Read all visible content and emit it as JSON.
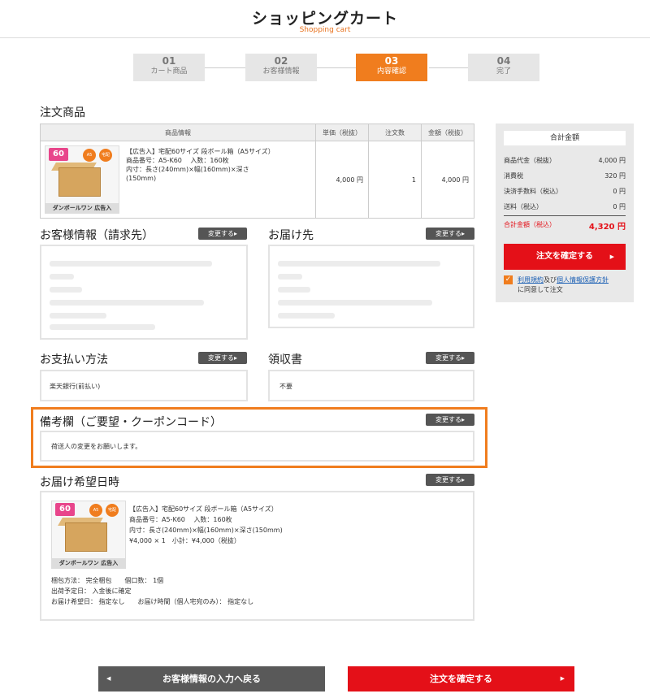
{
  "header": {
    "title": "ショッピングカート",
    "subtitle": "Shopping cart"
  },
  "steps": [
    {
      "num": "01",
      "label": "カート商品"
    },
    {
      "num": "02",
      "label": "お客様情報"
    },
    {
      "num": "03",
      "label": "内容確認"
    },
    {
      "num": "04",
      "label": "完了"
    }
  ],
  "order": {
    "title": "注文商品",
    "headers": {
      "info": "商品情報",
      "unit_price": "単価（税抜）",
      "qty": "注文数",
      "amount": "金額（税抜）"
    },
    "item": {
      "line1": "【広告入】宅配60サイズ 段ボール箱（A5サイズ）",
      "line2": "商品番号：A5-K60　 入数：160枚",
      "line3": "内寸：長さ(240mm)×幅(160mm)×深さ",
      "line4": "(150mm)",
      "unit_price": "4,000 円",
      "qty": "1",
      "amount": "4,000 円"
    },
    "img": {
      "badge": "60",
      "brand": "ダンボールワン 広告入",
      "c1": "A5",
      "c2": "宅配"
    }
  },
  "change_label": "変更する▸",
  "customer": {
    "title": "お客様情報（請求先）"
  },
  "delivery": {
    "title": "お届け先"
  },
  "payment": {
    "title": "お支払い方法",
    "value": "楽天銀行(前払い)"
  },
  "receipt": {
    "title": "領収書",
    "value": "不要"
  },
  "remarks": {
    "title": "備考欄（ご要望・クーポンコード）",
    "value": "荷送人の変更をお願いします。"
  },
  "delivery_date": {
    "title": "お届け希望日時",
    "line1": "【広告入】宅配60サイズ 段ボール箱（A5サイズ）",
    "line2": "商品番号：A5-K60　 入数：160枚",
    "line3": "内寸：長さ(240mm)×幅(160mm)×深さ(150mm)",
    "line4": "¥4,000 × 1　小計：¥4,000（税抜）",
    "pack": "梱包方法： 完全梱包　　個口数： 1個",
    "ship": "出荷予定日： 入金後に確定",
    "wish": "お届け希望日： 指定なし　　お届け時間（個人宅宛のみ）： 指定なし"
  },
  "summary": {
    "title": "合計金額",
    "rows": [
      {
        "label": "商品代金（税抜）",
        "value": "4,000 円"
      },
      {
        "label": "消費税",
        "value": "320 円"
      },
      {
        "label": "決済手数料（税込）",
        "value": "0 円"
      },
      {
        "label": "送料（税込）",
        "value": "0 円"
      }
    ],
    "total_label": "合計金額（税込）",
    "total_value": "4,320 円",
    "confirm": "注文を確定する",
    "terms_link1": "利用規約",
    "terms_mid": "及び",
    "terms_link2": "個人情報保護方針",
    "terms_tail": "に同意して注文"
  },
  "bottom": {
    "back": "お客様情報の入力へ戻る",
    "confirm": "注文を確定する"
  },
  "colors": {
    "accent": "#f07d1e",
    "red": "#e41018",
    "dark_button": "#595959"
  }
}
